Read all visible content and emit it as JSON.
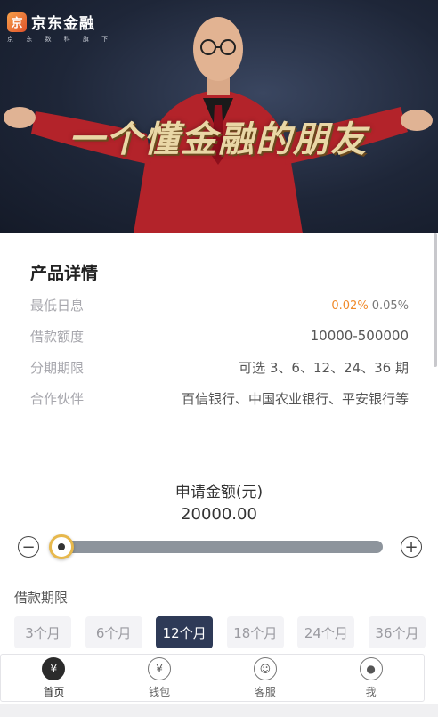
{
  "brand": {
    "name": "京东金融",
    "subtitle": "京 东 数 科 旗 下",
    "logo_letter": "京"
  },
  "banner": {
    "slogan": "一个懂金融的朋友"
  },
  "detail": {
    "title": "产品详情",
    "rows": [
      {
        "key": "最低日息",
        "value_new": "0.02%",
        "value_old": "0.05%"
      },
      {
        "key": "借款额度",
        "value": "10000-500000"
      },
      {
        "key": "分期期限",
        "value": "可选 3、6、12、24、36 期"
      },
      {
        "key": "合作伙伴",
        "value": "百信银行、中国农业银行、平安银行等"
      }
    ]
  },
  "amount": {
    "label": "申请金额(元)",
    "value": "20000.00",
    "minus": "−",
    "plus": "+",
    "slider_fraction": 0.02
  },
  "term": {
    "label": "借款期限",
    "options": [
      "3个月",
      "6个月",
      "12个月",
      "18个月",
      "24个月",
      "36个月"
    ],
    "selected": "12个月"
  },
  "nav": {
    "items": [
      {
        "label": "首页",
        "icon": "home-yen-icon",
        "glyph": "¥",
        "active": true
      },
      {
        "label": "钱包",
        "icon": "wallet-icon",
        "glyph": "¥",
        "active": false
      },
      {
        "label": "客服",
        "icon": "customer-service-icon",
        "glyph": "☺",
        "active": false
      },
      {
        "label": "我",
        "icon": "user-icon",
        "glyph": "●",
        "active": false
      }
    ]
  },
  "colors": {
    "accent": "#f08a2a",
    "primary": "#2e3a57",
    "thumb": "#e7b84c",
    "track": "#8d949c"
  }
}
